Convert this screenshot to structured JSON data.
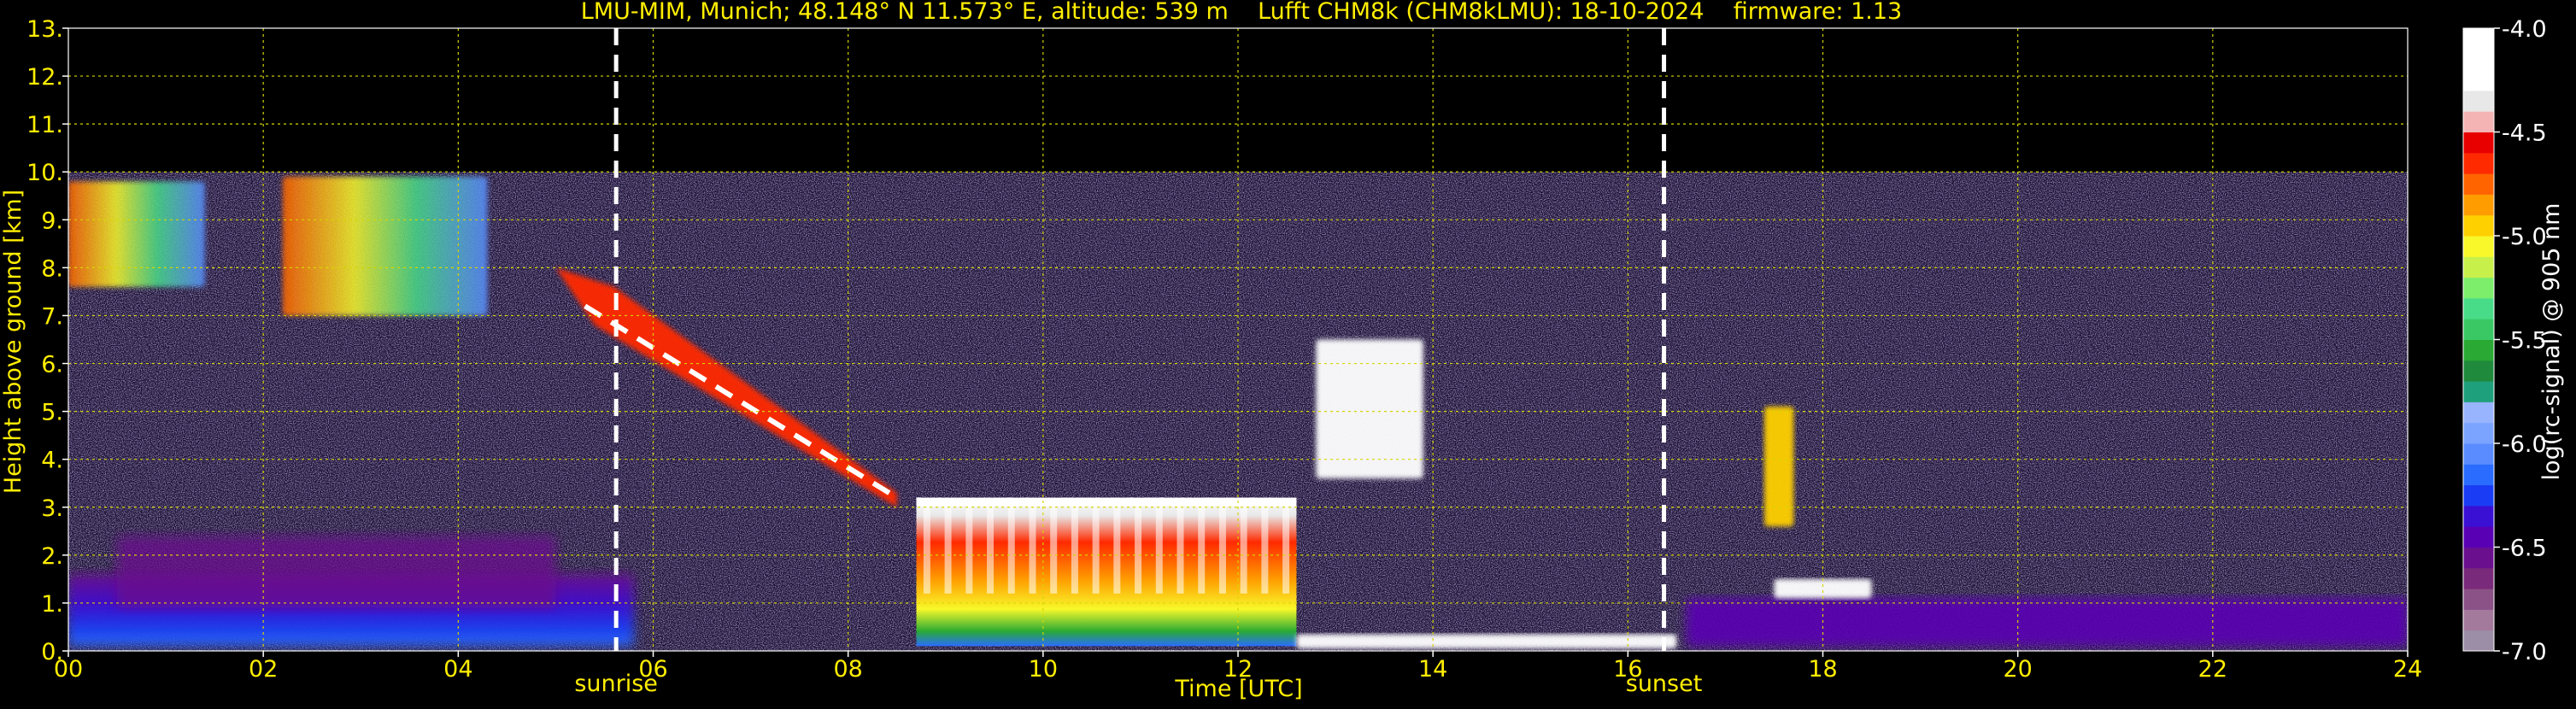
{
  "chart_data": {
    "type": "heatmap",
    "title": "LMU-MIM, Munich; 48.148° N 11.573° E, altitude: 539 m    Lufft CHM8k (CHM8kLMU): 18-10-2024    firmware: 1.13",
    "xlabel": "Time [UTC]",
    "ylabel": "Height above ground [km]",
    "colorbar_label": "log(rc-signal) @ 905 nm",
    "xlim": [
      0,
      24
    ],
    "ylim": [
      0,
      13
    ],
    "grid": true,
    "grid_color": "#d6d600",
    "text_color": "#ffee00",
    "colorbar_text_color": "#ffffff",
    "x_ticks": [
      {
        "value": 0,
        "label": "00"
      },
      {
        "value": 2,
        "label": "02"
      },
      {
        "value": 4,
        "label": "04"
      },
      {
        "value": 6,
        "label": "06"
      },
      {
        "value": 8,
        "label": "08"
      },
      {
        "value": 10,
        "label": "10"
      },
      {
        "value": 12,
        "label": "12"
      },
      {
        "value": 14,
        "label": "14"
      },
      {
        "value": 16,
        "label": "16"
      },
      {
        "value": 18,
        "label": "18"
      },
      {
        "value": 20,
        "label": "20"
      },
      {
        "value": 22,
        "label": "22"
      },
      {
        "value": 24,
        "label": "24"
      }
    ],
    "y_ticks": [
      {
        "value": 0,
        "label": "0."
      },
      {
        "value": 1,
        "label": "1."
      },
      {
        "value": 2,
        "label": "2."
      },
      {
        "value": 3,
        "label": "3."
      },
      {
        "value": 4,
        "label": "4."
      },
      {
        "value": 5,
        "label": "5."
      },
      {
        "value": 6,
        "label": "6."
      },
      {
        "value": 7,
        "label": "7."
      },
      {
        "value": 8,
        "label": "8."
      },
      {
        "value": 9,
        "label": "9."
      },
      {
        "value": 10,
        "label": "10."
      },
      {
        "value": 11,
        "label": "11."
      },
      {
        "value": 12,
        "label": "12."
      },
      {
        "value": 13,
        "label": "13."
      }
    ],
    "events": [
      {
        "time": 5.62,
        "label": "sunrise"
      },
      {
        "time": 16.37,
        "label": "sunset"
      }
    ],
    "colorbar": {
      "min": -7.0,
      "max": -4.0,
      "ticks": [
        {
          "value": -4.0,
          "label": "-4.0"
        },
        {
          "value": -4.5,
          "label": "-4.5"
        },
        {
          "value": -5.0,
          "label": "-5.0"
        },
        {
          "value": -5.5,
          "label": "-5.5"
        },
        {
          "value": -6.0,
          "label": "-6.0"
        },
        {
          "value": -6.5,
          "label": "-6.5"
        },
        {
          "value": -7.0,
          "label": "-7.0"
        }
      ],
      "colors": [
        "#9c8ea6",
        "#a47a9c",
        "#8a5286",
        "#7a2a7a",
        "#6a0f8e",
        "#5a00b4",
        "#3a10d4",
        "#1a3cf4",
        "#2a6cff",
        "#5a8cff",
        "#7aa4ff",
        "#98b4ff",
        "#1fa07c",
        "#1f8a3c",
        "#2aaa34",
        "#3ac864",
        "#48dc88",
        "#7cee6c",
        "#c8f04a",
        "#f8f82a",
        "#ffd000",
        "#ff9c00",
        "#ff6400",
        "#ff2a00",
        "#e80000",
        "#f4b4b4",
        "#e8e8e8",
        "#ffffff",
        "#ffffff",
        "#ffffff"
      ]
    },
    "backscatter_regions": [
      {
        "feature": "boundary layer aerosol",
        "t0": 0.0,
        "t1": 5.8,
        "z0": 0.1,
        "z1": 1.6,
        "level": -6.1
      },
      {
        "feature": "upper boundary layer",
        "t0": 0.5,
        "t1": 5.0,
        "z0": 0.9,
        "z1": 2.4,
        "level": -6.6
      },
      {
        "feature": "cirrus",
        "t0": 0.0,
        "t1": 1.4,
        "z0": 7.6,
        "z1": 9.8,
        "level": -5.1
      },
      {
        "feature": "cirrus",
        "t0": 2.2,
        "t1": 4.3,
        "z0": 7.0,
        "z1": 9.9,
        "level": -5.3
      },
      {
        "feature": "descending cloud layer",
        "t0": 5.0,
        "t1": 8.5,
        "z0": 3.0,
        "z1": 8.0,
        "level": -4.8
      },
      {
        "feature": "cloud deck",
        "t0": 8.7,
        "t1": 12.6,
        "z0": 0.1,
        "z1": 3.2,
        "level": -4.6
      },
      {
        "feature": "cloud fragments",
        "t0": 12.8,
        "t1": 13.9,
        "z0": 3.6,
        "z1": 6.5,
        "level": -4.3
      },
      {
        "feature": "nocturnal stable layer",
        "t0": 12.6,
        "t1": 16.5,
        "z0": 0.05,
        "z1": 0.35,
        "level": -4.2
      },
      {
        "feature": "convective column",
        "t0": 17.4,
        "t1": 17.7,
        "z0": 2.6,
        "z1": 5.1,
        "level": -5.0
      },
      {
        "feature": "evening aerosol layer",
        "t0": 16.6,
        "t1": 24.0,
        "z0": 0.1,
        "z1": 1.1,
        "level": -6.4
      },
      {
        "feature": "residual layer top",
        "t0": 17.5,
        "t1": 18.5,
        "z0": 1.1,
        "z1": 1.5,
        "level": -4.2
      }
    ]
  }
}
